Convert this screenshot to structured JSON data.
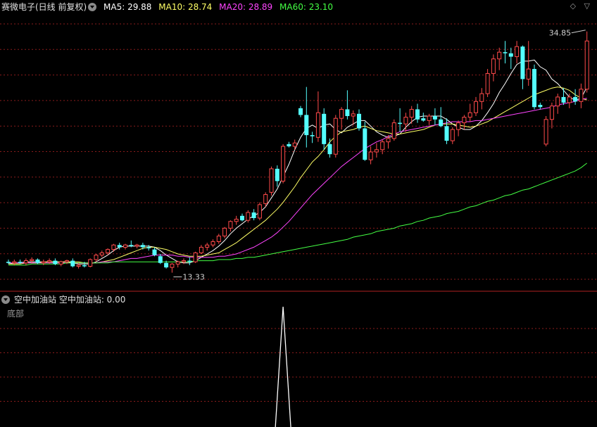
{
  "header": {
    "stock_label": "赛微电子(日线 前复权)",
    "ma5": {
      "label": "MA5: 29.88",
      "color": "#ffffff"
    },
    "ma10": {
      "label": "MA10: 28.74",
      "color": "#ffff66"
    },
    "ma20": {
      "label": "MA20: 28.89",
      "color": "#ff44ff"
    },
    "ma60": {
      "label": "MA60: 23.10",
      "color": "#44ff44"
    }
  },
  "sub_header": {
    "indicator_label": "空中加油站 空中加油站: 0.00",
    "sub_label": "底部"
  },
  "corner_icons": "◇ ▽",
  "colors": {
    "up": "#ff4a4a",
    "down": "#54ffff",
    "grid": "#8a1c1c",
    "divider": "#b02020",
    "signal": "#ffffff"
  },
  "chart_data": {
    "type": "candlestick",
    "ylim": [
      11.8,
      36.4
    ],
    "price_annotations": [
      {
        "label": "34.85",
        "value": 34.85,
        "bar_index": 99
      },
      {
        "label": "13.33",
        "value": 13.33,
        "bar_index": 28
      }
    ],
    "ohlc": [
      [
        14.3,
        14.5,
        14.1,
        14.2
      ],
      [
        14.2,
        14.5,
        14.0,
        14.3
      ],
      [
        14.3,
        14.5,
        14.1,
        14.2
      ],
      [
        14.2,
        14.6,
        14.0,
        14.4
      ],
      [
        14.4,
        14.7,
        14.2,
        14.5
      ],
      [
        14.5,
        14.6,
        14.1,
        14.2
      ],
      [
        14.2,
        14.5,
        14.0,
        14.3
      ],
      [
        14.3,
        14.6,
        14.1,
        14.4
      ],
      [
        14.4,
        14.6,
        14.0,
        14.1
      ],
      [
        14.1,
        14.4,
        13.9,
        14.3
      ],
      [
        14.3,
        14.5,
        14.1,
        14.4
      ],
      [
        14.4,
        14.6,
        13.8,
        13.9
      ],
      [
        13.9,
        14.2,
        13.7,
        14.0
      ],
      [
        14.0,
        14.3,
        13.8,
        13.9
      ],
      [
        13.9,
        14.6,
        13.8,
        14.5
      ],
      [
        14.5,
        15.0,
        14.3,
        14.9
      ],
      [
        14.9,
        15.3,
        14.7,
        15.1
      ],
      [
        15.1,
        15.5,
        14.9,
        15.4
      ],
      [
        15.4,
        15.9,
        15.2,
        15.8
      ],
      [
        15.8,
        16.0,
        15.4,
        15.6
      ],
      [
        15.6,
        15.9,
        15.4,
        15.8
      ],
      [
        15.8,
        16.2,
        15.6,
        15.7
      ],
      [
        15.7,
        15.9,
        15.5,
        15.8
      ],
      [
        15.8,
        16.0,
        15.4,
        15.6
      ],
      [
        15.6,
        15.8,
        15.3,
        15.5
      ],
      [
        15.4,
        15.6,
        14.8,
        14.9
      ],
      [
        14.8,
        15.0,
        14.1,
        14.2
      ],
      [
        14.2,
        14.4,
        13.7,
        13.8
      ],
      [
        13.8,
        14.2,
        13.33,
        14.1
      ],
      [
        14.1,
        14.4,
        13.8,
        14.3
      ],
      [
        14.3,
        14.6,
        14.1,
        14.4
      ],
      [
        14.4,
        14.7,
        14.0,
        14.3
      ],
      [
        14.3,
        15.2,
        14.2,
        15.1
      ],
      [
        15.1,
        15.8,
        15.0,
        15.6
      ],
      [
        15.6,
        16.0,
        15.3,
        15.8
      ],
      [
        15.8,
        16.3,
        15.6,
        16.1
      ],
      [
        16.1,
        16.8,
        15.9,
        16.6
      ],
      [
        16.6,
        17.4,
        16.4,
        17.3
      ],
      [
        17.3,
        18.0,
        17.0,
        17.9
      ],
      [
        17.9,
        18.4,
        17.6,
        18.1
      ],
      [
        18.4,
        18.6,
        17.9,
        18.0
      ],
      [
        18.0,
        18.9,
        17.8,
        18.7
      ],
      [
        18.7,
        19.0,
        18.0,
        18.2
      ],
      [
        18.2,
        19.6,
        18.0,
        19.4
      ],
      [
        19.5,
        20.5,
        19.2,
        20.3
      ],
      [
        20.5,
        22.8,
        20.2,
        22.6
      ],
      [
        22.6,
        22.9,
        21.0,
        21.5
      ],
      [
        21.5,
        24.8,
        21.3,
        24.6
      ],
      [
        24.8,
        25.0,
        24.5,
        24.6
      ],
      [
        24.6,
        25.2,
        24.3,
        24.9
      ],
      [
        28.0,
        28.2,
        27.2,
        27.4
      ],
      [
        27.4,
        29.9,
        24.5,
        25.6
      ],
      [
        25.6,
        25.9,
        24.9,
        25.5
      ],
      [
        25.4,
        29.5,
        25.0,
        27.6
      ],
      [
        27.5,
        28.0,
        24.3,
        24.8
      ],
      [
        24.8,
        25.3,
        23.6,
        23.9
      ],
      [
        23.9,
        27.4,
        23.6,
        27.1
      ],
      [
        27.1,
        28.1,
        26.1,
        27.9
      ],
      [
        27.9,
        29.6,
        27.0,
        27.3
      ],
      [
        27.3,
        27.8,
        26.5,
        27.5
      ],
      [
        27.5,
        27.9,
        26.0,
        26.2
      ],
      [
        26.2,
        26.8,
        23.3,
        23.4
      ],
      [
        23.4,
        24.6,
        23.0,
        24.1
      ],
      [
        24.1,
        24.9,
        23.6,
        24.3
      ],
      [
        24.3,
        25.2,
        23.9,
        25.0
      ],
      [
        25.0,
        25.6,
        24.4,
        25.3
      ],
      [
        25.3,
        27.0,
        25.1,
        26.7
      ],
      [
        26.7,
        28.0,
        25.9,
        26.6
      ],
      [
        26.6,
        27.6,
        25.9,
        27.2
      ],
      [
        27.2,
        28.2,
        26.6,
        27.9
      ],
      [
        27.9,
        28.4,
        26.7,
        27.0
      ],
      [
        27.1,
        27.6,
        26.8,
        26.9
      ],
      [
        26.9,
        27.5,
        26.5,
        27.3
      ],
      [
        27.3,
        28.0,
        26.5,
        27.0
      ],
      [
        27.0,
        28.1,
        26.3,
        26.4
      ],
      [
        26.4,
        27.1,
        24.8,
        25.1
      ],
      [
        25.1,
        26.3,
        24.8,
        26.1
      ],
      [
        26.1,
        26.9,
        25.5,
        26.7
      ],
      [
        26.7,
        27.4,
        26.1,
        27.2
      ],
      [
        27.2,
        28.4,
        26.8,
        27.6
      ],
      [
        27.6,
        29.0,
        27.3,
        28.6
      ],
      [
        28.6,
        29.8,
        27.9,
        29.3
      ],
      [
        29.3,
        31.5,
        29.0,
        31.1
      ],
      [
        31.1,
        32.8,
        30.4,
        32.4
      ],
      [
        32.4,
        33.4,
        31.4,
        33.0
      ],
      [
        33.0,
        34.0,
        32.0,
        32.9
      ],
      [
        32.9,
        33.4,
        31.5,
        32.6
      ],
      [
        32.6,
        34.0,
        32.0,
        33.5
      ],
      [
        33.5,
        33.6,
        29.7,
        30.6
      ],
      [
        30.6,
        34.0,
        30.0,
        31.5
      ],
      [
        31.5,
        31.9,
        27.9,
        28.1
      ],
      [
        28.3,
        28.5,
        27.9,
        28.1
      ],
      [
        24.8,
        27.3,
        24.6,
        27.0
      ],
      [
        27.0,
        28.5,
        26.2,
        28.2
      ],
      [
        28.2,
        29.3,
        27.5,
        29.0
      ],
      [
        29.0,
        29.8,
        28.3,
        28.5
      ],
      [
        28.5,
        29.3,
        28.0,
        29.0
      ],
      [
        29.0,
        29.7,
        28.3,
        28.6
      ],
      [
        28.6,
        30.2,
        28.0,
        29.7
      ],
      [
        29.7,
        34.85,
        29.4,
        34.0
      ]
    ],
    "series": [
      {
        "name": "MA5",
        "values": [
          14.1,
          14.2,
          14.2,
          14.3,
          14.3,
          14.3,
          14.3,
          14.3,
          14.3,
          14.3,
          14.3,
          14.2,
          14.1,
          14.1,
          14.1,
          14.3,
          14.6,
          14.9,
          15.3,
          15.6,
          15.7,
          15.7,
          15.7,
          15.7,
          15.7,
          15.6,
          15.3,
          14.9,
          14.6,
          14.3,
          14.2,
          14.2,
          14.4,
          14.7,
          15.0,
          15.3,
          15.7,
          16.2,
          16.8,
          17.3,
          17.7,
          18.1,
          18.4,
          18.7,
          19.2,
          20.0,
          20.8,
          21.9,
          23.0,
          24.3,
          25.4,
          26.2,
          26.5,
          26.2,
          26.5,
          26.6,
          26.1,
          25.8,
          26.3,
          26.6,
          26.9,
          26.9,
          26.4,
          25.9,
          25.6,
          25.4,
          25.5,
          25.7,
          26.3,
          26.8,
          27.2,
          27.3,
          27.3,
          27.3,
          27.3,
          27.0,
          26.6,
          26.3,
          26.1,
          26.1,
          26.4,
          26.9,
          27.6,
          28.4,
          29.4,
          30.2,
          31.1,
          31.9,
          32.2,
          32.2,
          32.3,
          31.7,
          31.4,
          30.6,
          30.2,
          29.6,
          29.0,
          28.7,
          28.9,
          29.88
        ]
      },
      {
        "name": "MA10",
        "values": [
          14.1,
          14.1,
          14.1,
          14.2,
          14.2,
          14.2,
          14.3,
          14.3,
          14.3,
          14.3,
          14.3,
          14.3,
          14.3,
          14.2,
          14.2,
          14.2,
          14.3,
          14.4,
          14.5,
          14.7,
          14.9,
          15.1,
          15.3,
          15.5,
          15.6,
          15.6,
          15.5,
          15.4,
          15.2,
          15.0,
          14.9,
          14.8,
          14.8,
          14.8,
          14.9,
          15.0,
          15.1,
          15.4,
          15.7,
          16.0,
          16.4,
          16.8,
          17.2,
          17.6,
          18.0,
          18.5,
          19.0,
          19.6,
          20.3,
          21.0,
          21.8,
          22.5,
          23.2,
          23.7,
          24.3,
          25.0,
          25.5,
          25.9,
          26.0,
          26.1,
          26.3,
          26.4,
          26.2,
          26.0,
          25.9,
          25.8,
          25.7,
          25.7,
          25.8,
          25.9,
          26.0,
          26.1,
          26.3,
          26.5,
          26.6,
          26.6,
          26.6,
          26.5,
          26.4,
          26.3,
          26.4,
          26.6,
          26.8,
          27.1,
          27.4,
          27.7,
          28.0,
          28.3,
          28.6,
          28.9,
          29.2,
          29.4,
          29.6,
          29.8,
          29.9,
          29.8,
          29.6,
          29.2,
          28.9,
          28.74
        ]
      },
      {
        "name": "MA20",
        "values": [
          14.2,
          14.2,
          14.2,
          14.2,
          14.2,
          14.2,
          14.2,
          14.2,
          14.2,
          14.2,
          14.2,
          14.2,
          14.2,
          14.2,
          14.2,
          14.2,
          14.3,
          14.3,
          14.3,
          14.4,
          14.5,
          14.6,
          14.6,
          14.7,
          14.8,
          14.9,
          14.9,
          14.9,
          14.9,
          14.8,
          14.8,
          14.7,
          14.7,
          14.7,
          14.7,
          14.7,
          14.8,
          14.8,
          14.9,
          15.0,
          15.2,
          15.4,
          15.6,
          15.9,
          16.2,
          16.5,
          16.9,
          17.4,
          17.9,
          18.5,
          19.1,
          19.7,
          20.3,
          20.8,
          21.3,
          21.8,
          22.3,
          22.8,
          23.2,
          23.6,
          24.0,
          24.4,
          24.7,
          25.0,
          25.2,
          25.5,
          25.7,
          25.9,
          26.0,
          26.1,
          26.2,
          26.3,
          26.4,
          26.5,
          26.6,
          26.7,
          26.8,
          26.8,
          26.8,
          26.8,
          26.9,
          26.9,
          27.0,
          27.1,
          27.2,
          27.3,
          27.4,
          27.5,
          27.6,
          27.7,
          27.8,
          27.9,
          28.0,
          28.1,
          28.3,
          28.4,
          28.5,
          28.6,
          28.8,
          28.89
        ]
      },
      {
        "name": "MA60",
        "values": [
          14.0,
          14.0,
          14.0,
          14.0,
          14.1,
          14.1,
          14.1,
          14.1,
          14.1,
          14.1,
          14.2,
          14.2,
          14.2,
          14.2,
          14.2,
          14.2,
          14.2,
          14.2,
          14.3,
          14.3,
          14.3,
          14.3,
          14.3,
          14.3,
          14.3,
          14.3,
          14.3,
          14.3,
          14.3,
          14.3,
          14.3,
          14.3,
          14.4,
          14.4,
          14.4,
          14.4,
          14.5,
          14.5,
          14.5,
          14.6,
          14.6,
          14.7,
          14.7,
          14.8,
          14.9,
          15.0,
          15.1,
          15.2,
          15.3,
          15.4,
          15.5,
          15.6,
          15.7,
          15.8,
          15.9,
          16.0,
          16.1,
          16.2,
          16.3,
          16.5,
          16.6,
          16.7,
          16.8,
          17.0,
          17.1,
          17.2,
          17.3,
          17.5,
          17.6,
          17.7,
          17.9,
          18.0,
          18.2,
          18.3,
          18.4,
          18.6,
          18.7,
          18.8,
          19.0,
          19.2,
          19.3,
          19.5,
          19.7,
          19.8,
          20.0,
          20.2,
          20.3,
          20.5,
          20.7,
          20.8,
          21.0,
          21.2,
          21.4,
          21.6,
          21.8,
          22.0,
          22.2,
          22.4,
          22.7,
          23.1
        ]
      }
    ],
    "indicator": {
      "name": "空中加油站",
      "value": 0.0,
      "spike_bar_index": 47,
      "spike_value": 1.0
    }
  }
}
